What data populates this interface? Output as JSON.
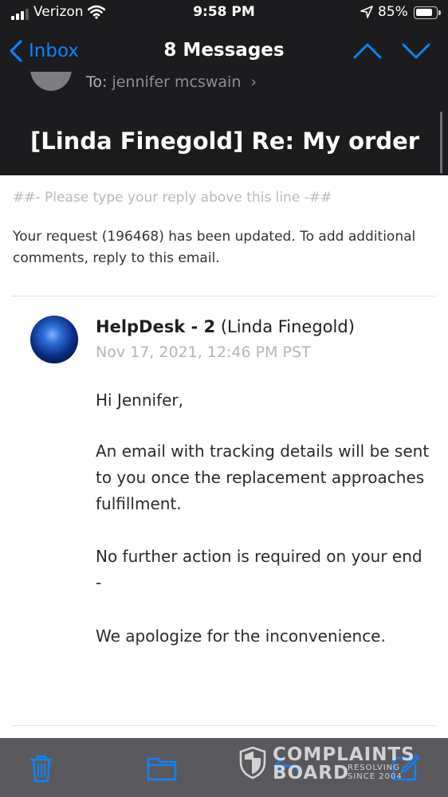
{
  "status_bar": {
    "carrier": "Verizon",
    "time": "9:58 PM",
    "battery": "85%",
    "battery_level": 0.85,
    "signal_bars_on": 3,
    "signal_bars_total": 4
  },
  "nav": {
    "back_label": "Inbox",
    "title": "8 Messages",
    "accent_color": "#0a84ff"
  },
  "header": {
    "to_label": "To:",
    "to_value": "jennifer mcswain",
    "subject": "[Linda Finegold] Re: My order"
  },
  "email": {
    "reply_line": "##- Please type your reply above this line -##",
    "notice": "Your request (196468) has been updated. To add additional comments, reply to this email.",
    "author_name": "HelpDesk - 2",
    "author_detail": "(Linda Finegold)",
    "date": "Nov 17, 2021, 12:46 PM PST",
    "greeting": "Hi Jennifer,",
    "paragraph1": "An email with tracking details will be sent to you once the replacement approaches fulfillment.",
    "paragraph2": "No further action is required on your end -",
    "paragraph3": "We apologize for the inconvenience."
  },
  "toolbar": {
    "icons": [
      "trash-icon",
      "folder-icon",
      "reply-icon",
      "compose-icon"
    ],
    "icon_color": "#0a84ff"
  },
  "watermark": {
    "line1": "COMPLAINTS",
    "line2": "BOARD",
    "tag1": "RESOLVING",
    "tag2": "SINCE 2004"
  }
}
